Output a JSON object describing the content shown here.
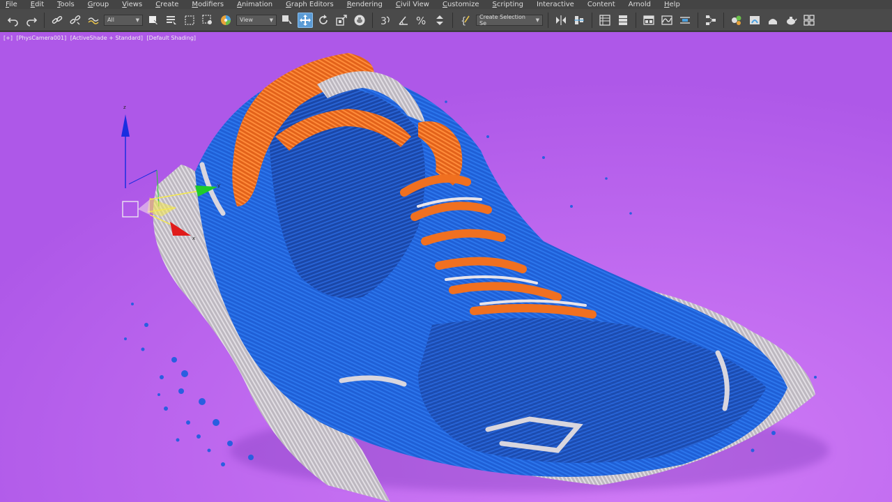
{
  "menu": [
    {
      "label": "File",
      "u": "F"
    },
    {
      "label": "Edit",
      "u": "E"
    },
    {
      "label": "Tools",
      "u": "T"
    },
    {
      "label": "Group",
      "u": "G"
    },
    {
      "label": "Views",
      "u": "V"
    },
    {
      "label": "Create",
      "u": "C"
    },
    {
      "label": "Modifiers",
      "u": "M"
    },
    {
      "label": "Animation",
      "u": "A"
    },
    {
      "label": "Graph Editors",
      "u": "G"
    },
    {
      "label": "Rendering",
      "u": "R"
    },
    {
      "label": "Civil View",
      "u": "C"
    },
    {
      "label": "Customize",
      "u": "C"
    },
    {
      "label": "Scripting",
      "u": "S"
    },
    {
      "label": "Interactive",
      "u": ""
    },
    {
      "label": "Content",
      "u": ""
    },
    {
      "label": "Arnold",
      "u": ""
    },
    {
      "label": "Help",
      "u": "H"
    }
  ],
  "toolbar": {
    "selection_filter": "All",
    "reference_coord": "View",
    "named_selection": "Create Selection Se"
  },
  "viewport": {
    "labels": [
      "[+]",
      "[PhysCamera001]",
      "[ActiveShade + Standard]",
      "[Default Shading]"
    ]
  },
  "gizmo": {
    "x_axis_label": "x",
    "y_axis_label": "y",
    "z_axis_label": "z",
    "x_color": "#e01b1b",
    "y_color": "#1fcc2a",
    "z_color": "#1a2ee0",
    "plane_color": "#f5e94a"
  },
  "colors": {
    "active_tool": "#5b9bd5",
    "background": "#b25bea",
    "shoe_blue": "#1f5fd6",
    "shoe_orange": "#f06e1c",
    "shoe_grey": "#c9c4cc"
  }
}
